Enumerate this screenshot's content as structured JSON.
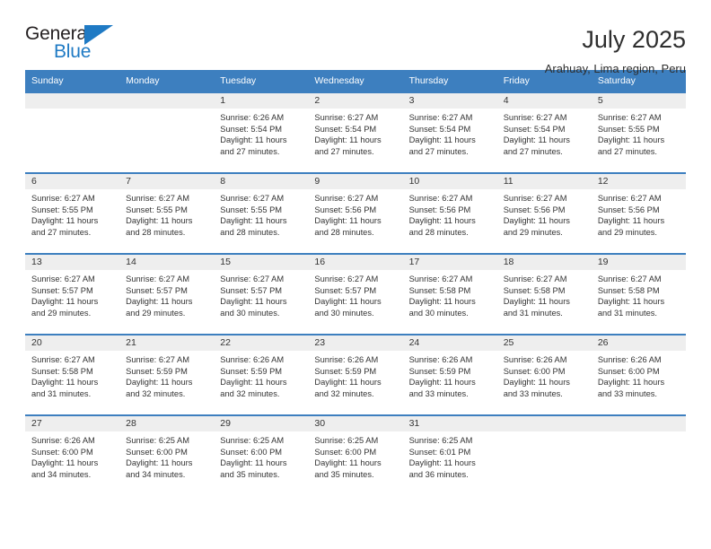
{
  "logo": {
    "word1": "General",
    "word2": "Blue",
    "accent_color": "#1f7ac4",
    "triangle_icon": "triangle-icon"
  },
  "header": {
    "title": "July 2025",
    "subtitle": "Arahuay, Lima region, Peru"
  },
  "calendar": {
    "header_bg": "#3d7fbf",
    "weekday_headers": [
      "Sunday",
      "Monday",
      "Tuesday",
      "Wednesday",
      "Thursday",
      "Friday",
      "Saturday"
    ],
    "labels": {
      "sunrise": "Sunrise:",
      "sunset": "Sunset:",
      "daylight": "Daylight:"
    },
    "weeks": [
      [
        {
          "day": ""
        },
        {
          "day": ""
        },
        {
          "day": "1",
          "sunrise": "Sunrise: 6:26 AM",
          "sunset": "Sunset: 5:54 PM",
          "daylight": "Daylight: 11 hours and 27 minutes."
        },
        {
          "day": "2",
          "sunrise": "Sunrise: 6:27 AM",
          "sunset": "Sunset: 5:54 PM",
          "daylight": "Daylight: 11 hours and 27 minutes."
        },
        {
          "day": "3",
          "sunrise": "Sunrise: 6:27 AM",
          "sunset": "Sunset: 5:54 PM",
          "daylight": "Daylight: 11 hours and 27 minutes."
        },
        {
          "day": "4",
          "sunrise": "Sunrise: 6:27 AM",
          "sunset": "Sunset: 5:54 PM",
          "daylight": "Daylight: 11 hours and 27 minutes."
        },
        {
          "day": "5",
          "sunrise": "Sunrise: 6:27 AM",
          "sunset": "Sunset: 5:55 PM",
          "daylight": "Daylight: 11 hours and 27 minutes."
        }
      ],
      [
        {
          "day": "6",
          "sunrise": "Sunrise: 6:27 AM",
          "sunset": "Sunset: 5:55 PM",
          "daylight": "Daylight: 11 hours and 27 minutes."
        },
        {
          "day": "7",
          "sunrise": "Sunrise: 6:27 AM",
          "sunset": "Sunset: 5:55 PM",
          "daylight": "Daylight: 11 hours and 28 minutes."
        },
        {
          "day": "8",
          "sunrise": "Sunrise: 6:27 AM",
          "sunset": "Sunset: 5:55 PM",
          "daylight": "Daylight: 11 hours and 28 minutes."
        },
        {
          "day": "9",
          "sunrise": "Sunrise: 6:27 AM",
          "sunset": "Sunset: 5:56 PM",
          "daylight": "Daylight: 11 hours and 28 minutes."
        },
        {
          "day": "10",
          "sunrise": "Sunrise: 6:27 AM",
          "sunset": "Sunset: 5:56 PM",
          "daylight": "Daylight: 11 hours and 28 minutes."
        },
        {
          "day": "11",
          "sunrise": "Sunrise: 6:27 AM",
          "sunset": "Sunset: 5:56 PM",
          "daylight": "Daylight: 11 hours and 29 minutes."
        },
        {
          "day": "12",
          "sunrise": "Sunrise: 6:27 AM",
          "sunset": "Sunset: 5:56 PM",
          "daylight": "Daylight: 11 hours and 29 minutes."
        }
      ],
      [
        {
          "day": "13",
          "sunrise": "Sunrise: 6:27 AM",
          "sunset": "Sunset: 5:57 PM",
          "daylight": "Daylight: 11 hours and 29 minutes."
        },
        {
          "day": "14",
          "sunrise": "Sunrise: 6:27 AM",
          "sunset": "Sunset: 5:57 PM",
          "daylight": "Daylight: 11 hours and 29 minutes."
        },
        {
          "day": "15",
          "sunrise": "Sunrise: 6:27 AM",
          "sunset": "Sunset: 5:57 PM",
          "daylight": "Daylight: 11 hours and 30 minutes."
        },
        {
          "day": "16",
          "sunrise": "Sunrise: 6:27 AM",
          "sunset": "Sunset: 5:57 PM",
          "daylight": "Daylight: 11 hours and 30 minutes."
        },
        {
          "day": "17",
          "sunrise": "Sunrise: 6:27 AM",
          "sunset": "Sunset: 5:58 PM",
          "daylight": "Daylight: 11 hours and 30 minutes."
        },
        {
          "day": "18",
          "sunrise": "Sunrise: 6:27 AM",
          "sunset": "Sunset: 5:58 PM",
          "daylight": "Daylight: 11 hours and 31 minutes."
        },
        {
          "day": "19",
          "sunrise": "Sunrise: 6:27 AM",
          "sunset": "Sunset: 5:58 PM",
          "daylight": "Daylight: 11 hours and 31 minutes."
        }
      ],
      [
        {
          "day": "20",
          "sunrise": "Sunrise: 6:27 AM",
          "sunset": "Sunset: 5:58 PM",
          "daylight": "Daylight: 11 hours and 31 minutes."
        },
        {
          "day": "21",
          "sunrise": "Sunrise: 6:27 AM",
          "sunset": "Sunset: 5:59 PM",
          "daylight": "Daylight: 11 hours and 32 minutes."
        },
        {
          "day": "22",
          "sunrise": "Sunrise: 6:26 AM",
          "sunset": "Sunset: 5:59 PM",
          "daylight": "Daylight: 11 hours and 32 minutes."
        },
        {
          "day": "23",
          "sunrise": "Sunrise: 6:26 AM",
          "sunset": "Sunset: 5:59 PM",
          "daylight": "Daylight: 11 hours and 32 minutes."
        },
        {
          "day": "24",
          "sunrise": "Sunrise: 6:26 AM",
          "sunset": "Sunset: 5:59 PM",
          "daylight": "Daylight: 11 hours and 33 minutes."
        },
        {
          "day": "25",
          "sunrise": "Sunrise: 6:26 AM",
          "sunset": "Sunset: 6:00 PM",
          "daylight": "Daylight: 11 hours and 33 minutes."
        },
        {
          "day": "26",
          "sunrise": "Sunrise: 6:26 AM",
          "sunset": "Sunset: 6:00 PM",
          "daylight": "Daylight: 11 hours and 33 minutes."
        }
      ],
      [
        {
          "day": "27",
          "sunrise": "Sunrise: 6:26 AM",
          "sunset": "Sunset: 6:00 PM",
          "daylight": "Daylight: 11 hours and 34 minutes."
        },
        {
          "day": "28",
          "sunrise": "Sunrise: 6:25 AM",
          "sunset": "Sunset: 6:00 PM",
          "daylight": "Daylight: 11 hours and 34 minutes."
        },
        {
          "day": "29",
          "sunrise": "Sunrise: 6:25 AM",
          "sunset": "Sunset: 6:00 PM",
          "daylight": "Daylight: 11 hours and 35 minutes."
        },
        {
          "day": "30",
          "sunrise": "Sunrise: 6:25 AM",
          "sunset": "Sunset: 6:00 PM",
          "daylight": "Daylight: 11 hours and 35 minutes."
        },
        {
          "day": "31",
          "sunrise": "Sunrise: 6:25 AM",
          "sunset": "Sunset: 6:01 PM",
          "daylight": "Daylight: 11 hours and 36 minutes."
        },
        {
          "day": ""
        },
        {
          "day": ""
        }
      ]
    ]
  }
}
